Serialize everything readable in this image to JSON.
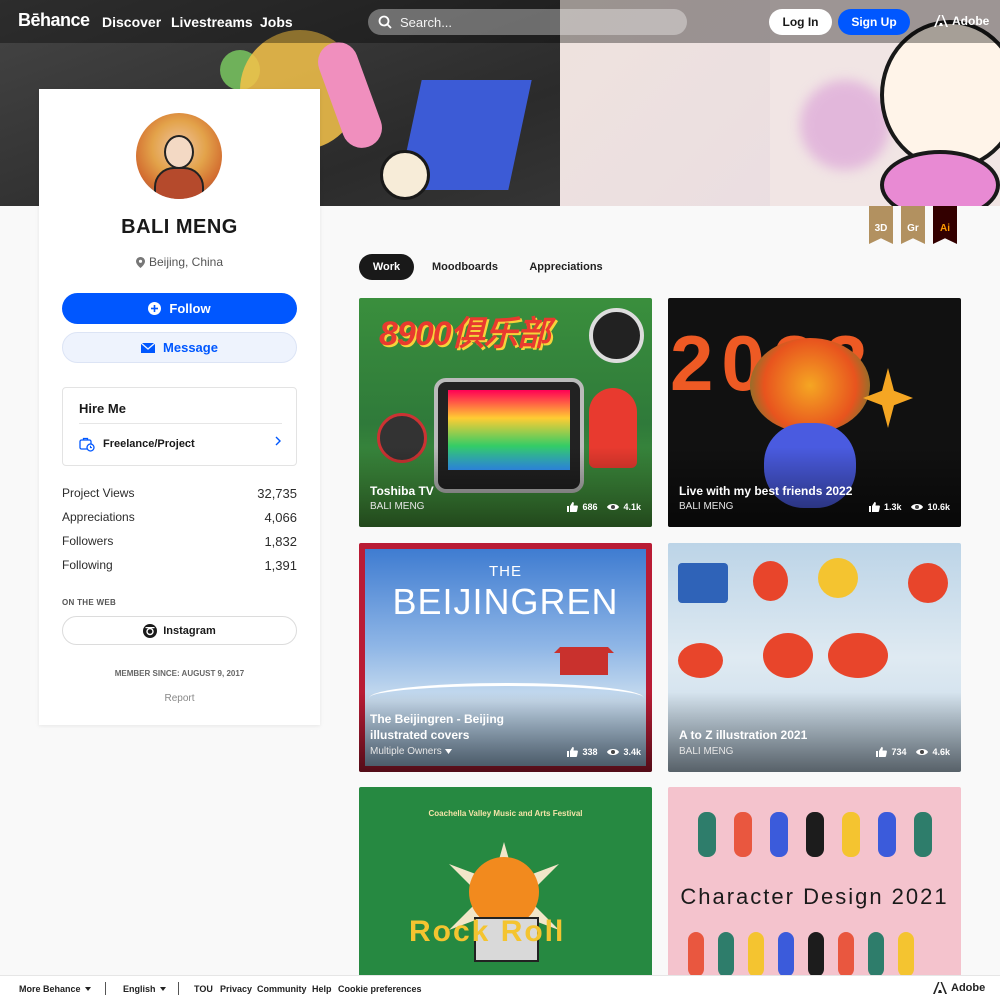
{
  "nav": {
    "logo": "Bēhance",
    "links": [
      "Discover",
      "Livestreams",
      "Jobs"
    ],
    "search_placeholder": "Search...",
    "login": "Log In",
    "signup": "Sign Up",
    "adobe": "Adobe"
  },
  "profile": {
    "name": "BALI MENG",
    "location": "Beijing, China",
    "follow": "Follow",
    "message": "Message",
    "hire_title": "Hire Me",
    "hire_item": "Freelance/Project",
    "stats": [
      {
        "label": "Project Views",
        "value": "32,735"
      },
      {
        "label": "Appreciations",
        "value": "4,066"
      },
      {
        "label": "Followers",
        "value": "1,832"
      },
      {
        "label": "Following",
        "value": "1,391"
      }
    ],
    "on_web": "ON THE WEB",
    "instagram": "Instagram",
    "member_since": "MEMBER SINCE: AUGUST 9, 2017",
    "report": "Report"
  },
  "ribbons": [
    {
      "label": "3D",
      "bg": "#b29160",
      "fg": "#fff"
    },
    {
      "label": "Gr",
      "bg": "#b29160",
      "fg": "#fff"
    },
    {
      "label": "Ai",
      "bg": "#330000",
      "fg": "#ff9a00"
    }
  ],
  "tabs": [
    "Work",
    "Moodboards",
    "Appreciations"
  ],
  "projects": [
    {
      "title": "Toshiba TV",
      "owner": "BALI MENG",
      "likes": "686",
      "views": "4.1k",
      "art_text": "8900俱乐部"
    },
    {
      "title": "Live with my best friends 2022",
      "owner": "BALI MENG",
      "likes": "1.3k",
      "views": "10.6k",
      "art_text": "2022"
    },
    {
      "title": "The Beijingren - Beijing illustrated covers",
      "owner": "Multiple Owners",
      "likes": "338",
      "views": "3.4k",
      "art_text_small": "THE",
      "art_text": "BEIJINGREN"
    },
    {
      "title": "A to Z illustration 2021",
      "owner": "BALI MENG",
      "likes": "734",
      "views": "4.6k"
    },
    {
      "art_text_small": "Coachella Valley Music and Arts Festival",
      "art_text": "Rock Roll"
    },
    {
      "art_text": "Character Design 2021"
    }
  ],
  "footer": {
    "more": "More Behance",
    "language": "English",
    "links": [
      "TOU",
      "Privacy",
      "Community",
      "Help",
      "Cookie preferences"
    ],
    "adobe": "Adobe"
  },
  "colors": {
    "brand_blue": "#0057ff",
    "dark": "#191919"
  }
}
